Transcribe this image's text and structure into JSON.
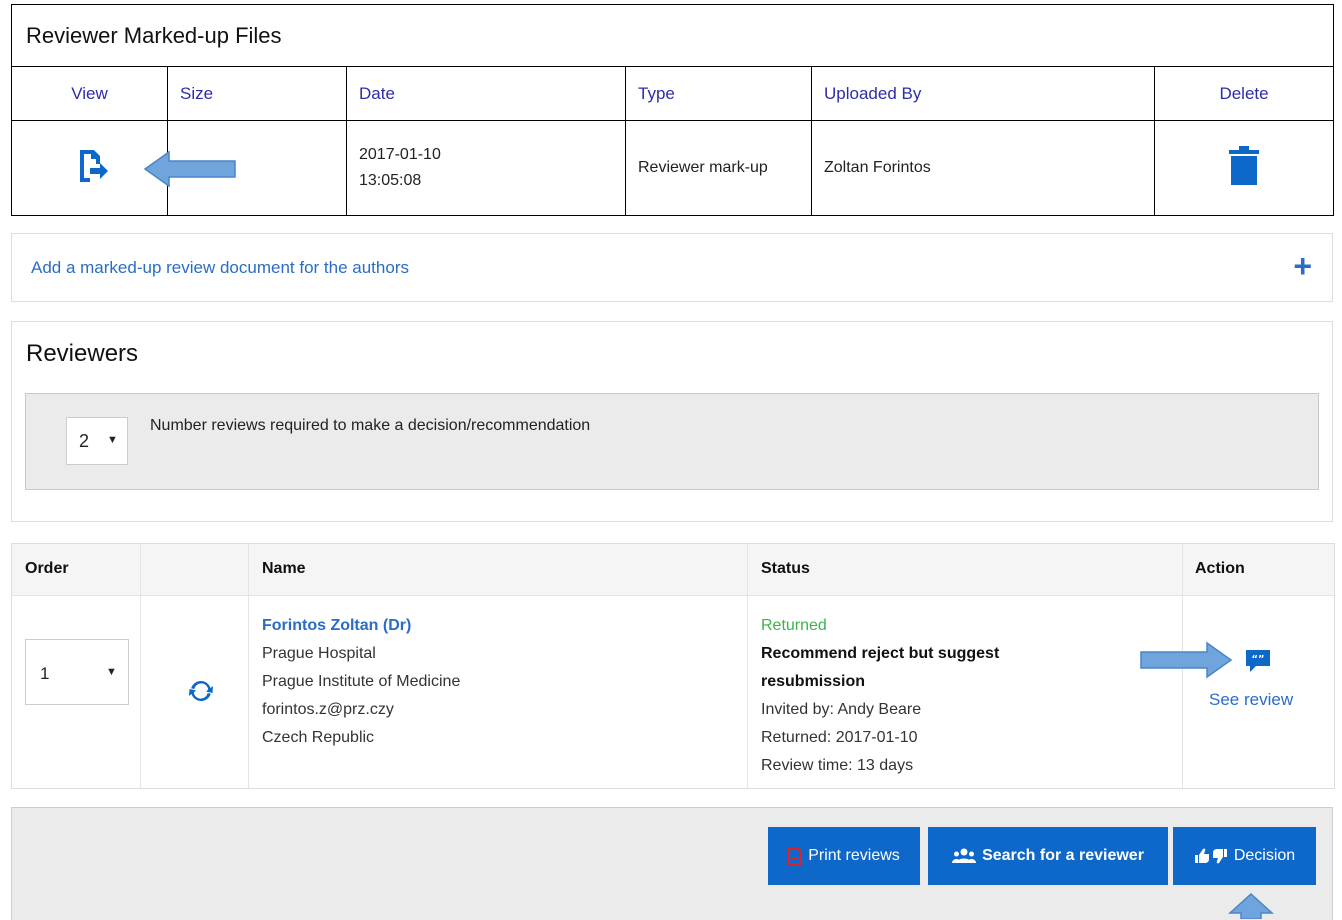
{
  "files": {
    "title": "Reviewer Marked-up Files",
    "columns": [
      "View",
      "Size",
      "Date",
      "Type",
      "Uploaded By",
      "Delete"
    ],
    "rows": [
      {
        "size": "",
        "date_line1": "2017-01-10",
        "date_line2": "13:05:08",
        "type": "Reviewer mark-up",
        "uploaded_by": "Zoltan Forintos"
      }
    ]
  },
  "add_markup": {
    "label": "Add a marked-up review document for the authors",
    "plus": "+"
  },
  "reviewers": {
    "title": "Reviewers",
    "required_count": "2",
    "required_label": "Number reviews required to make a decision/recommendation",
    "columns": {
      "order": "Order",
      "name": "Name",
      "status": "Status",
      "action": "Action"
    },
    "rows": [
      {
        "order": "1",
        "name": "Forintos Zoltan (Dr)",
        "affiliation1": "Prague Hospital",
        "affiliation2": "Prague Institute of Medicine",
        "email": "forintos.z@prz.czy",
        "country": "Czech Republic",
        "status": "Returned",
        "recommendation_line1": "Recommend reject but suggest",
        "recommendation_line2": "resubmission",
        "invited_by": "Invited by: Andy Beare",
        "returned": "Returned: 2017-01-10",
        "review_time": "Review time: 13 days",
        "action_label": "See review"
      }
    ]
  },
  "buttons": {
    "print": "Print reviews",
    "search": "Search for a reviewer",
    "decision": "Decision"
  },
  "colors": {
    "link": "#2a6dc4",
    "header_text": "#2d2da8",
    "primary_button": "#0d68c9",
    "status_green": "#3cb34a",
    "icon_blue": "#0d68c9",
    "arrow_fill": "#6fa5dc"
  }
}
